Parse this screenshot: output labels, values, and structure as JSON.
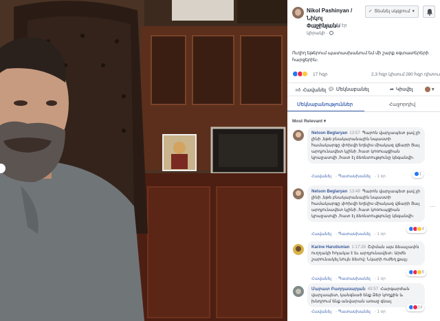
{
  "page": {
    "name_line1": "Nikol Pashinyan /",
    "name_line2": "Նիկոլ",
    "name_line3": "Փաշինյան",
    "name_suffix": "ն",
    "meta_line1": "ուղիղ եթերում էր",
    "meta_line2": "կիրակի ·",
    "follow_label": "Տեսնել սկզբում",
    "description": "Ուղիղ եթերում պատասխանում եմ մի շարք օգտատերերի հարցերին։"
  },
  "stats": {
    "reactions_count": "17 հզր",
    "shares": "2,3 հզր կիսում",
    "views": "280 հզր դիտում"
  },
  "actions": {
    "like": "Հավանել",
    "comment": "Մեկնաբանել",
    "share": "Կիսվել"
  },
  "tabs": {
    "comments": "Մեկնաբանություններ",
    "details": "Հաջորդիվ"
  },
  "sort_label": "Most Relevant ▾",
  "comments": [
    {
      "author": "Nelson Beglaryan",
      "time": "13:57",
      "text": "Պարոն վարչապետ լավ չի լինի ,եթե բնակարանային նպաստի համակարգը փոխվի եղելիս միակազ վճարի Յալ արդյունավետ կլինի ,հատ կոռուպցիան կրաջատվի ,հատ էլ ձեռնտուլթյունը կեգանվի։",
      "like_label": "Հավանել",
      "reply_label": "Պատասխանել",
      "ago": "1 օր",
      "react_count": "1"
    },
    {
      "author": "Nelson Beglaryan",
      "time": "13:49",
      "text": "Պարոն վարչապետ լավ չի լինի ,եթե բնակարանային նպաստի համակարգը փոխվի եղելիս միակազ վճարի Յալ արդյունավետ կլինի ,հատ կոռուպցիան կրաջատվի ,հատ էլ ձեռնտուլթյունը կեգանվի։",
      "like_label": "Հավանել",
      "reply_label": "Պատասխանել",
      "ago": "1 օր",
      "react_count": "4"
    },
    {
      "author": "Karine Harutiunian",
      "time": "1:17:26",
      "text": "Շփման այս ձեւաչափն ուղղակի հոյակա է եւ արդյունավետ։ Արժե շարունակել նույն ձեւով։ Նկարի ուժեղ քայլ։",
      "like_label": "Հավանել",
      "reply_label": "Պատասխանել",
      "ago": "1 օր",
      "react_count": "6"
    },
    {
      "author": "Մարատ Բաղդասարյան",
      "time": "43:57",
      "text": "Հարգարժան վարչապետ, կանգնած ենք Ձեր կողքին և խնդրում ենք անվարան առաջ գնալ",
      "like_label": "Հավանել",
      "reply_label": "Պատասխանել",
      "ago": "1 օր",
      "react_count": "14"
    }
  ],
  "colors": {
    "accent": "#4267b2",
    "author": "#385898",
    "muted": "#90949c",
    "bubble": "#f2f3f5"
  }
}
